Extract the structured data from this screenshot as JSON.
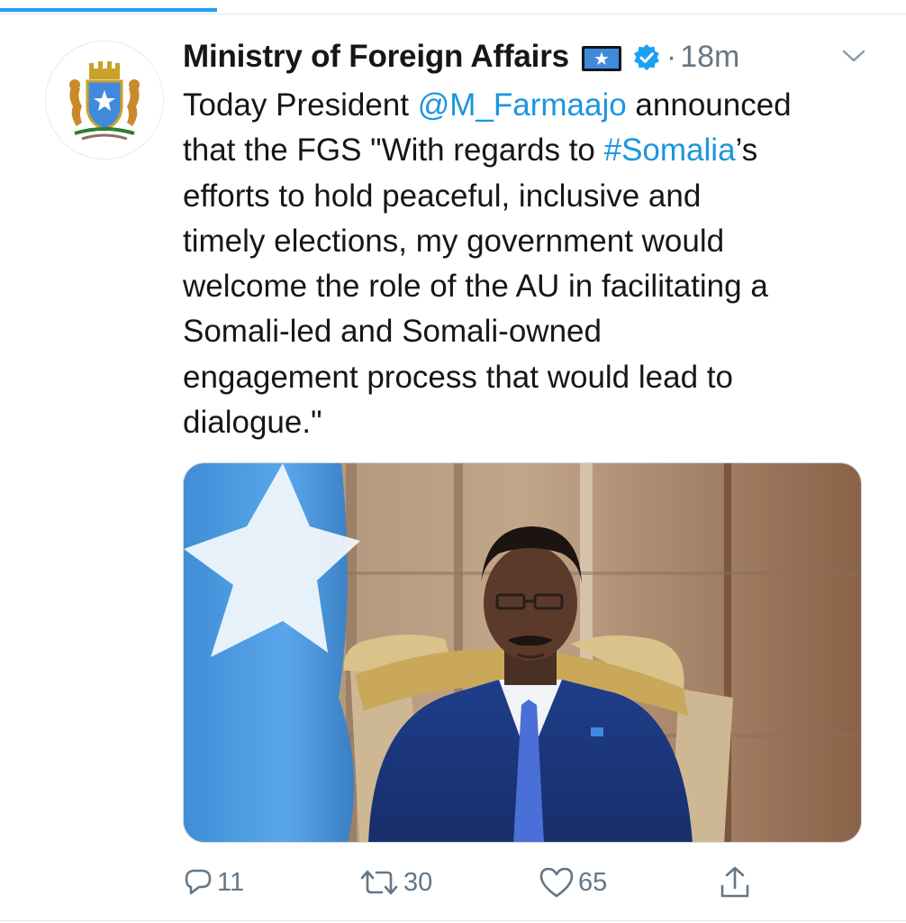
{
  "tweet": {
    "author_name": "Ministry of Foreign Affairs",
    "separator": "·",
    "time": "18m",
    "text_lines": [
      [
        {
          "t": "Today President ",
          "link": false
        },
        {
          "t": "@M_Farmaajo",
          "link": true
        },
        {
          "t": " announced",
          "link": false
        }
      ],
      [
        {
          "t": "that the FGS \"With regards to ",
          "link": false
        },
        {
          "t": "#Somalia",
          "link": true
        },
        {
          "t": "’s",
          "link": false
        }
      ],
      [
        {
          "t": "efforts to hold peaceful, inclusive and",
          "link": false
        }
      ],
      [
        {
          "t": "timely elections, my government would",
          "link": false
        }
      ],
      [
        {
          "t": "welcome the role of the AU in facilitating a",
          "link": false
        }
      ],
      [
        {
          "t": "Somali-led and Somali-owned",
          "link": false
        }
      ],
      [
        {
          "t": "engagement process that would lead to",
          "link": false
        }
      ],
      [
        {
          "t": "dialogue.\"",
          "link": false
        }
      ]
    ]
  },
  "actions": {
    "reply_count": "11",
    "retweet_count": "30",
    "like_count": "65"
  },
  "icons": {
    "avatar": "coat-of-arms-icon",
    "flag": "somalia-flag-icon",
    "verified": "verified-badge-icon",
    "menu": "chevron-down-icon",
    "reply": "reply-icon",
    "retweet": "retweet-icon",
    "like": "heart-icon",
    "share": "share-icon"
  },
  "colors": {
    "link": "#1b95e0",
    "verified": "#1da1f2",
    "muted": "#657786",
    "text": "#14171a",
    "flag_blue": "#4189dd"
  },
  "load_progress": 0.24
}
